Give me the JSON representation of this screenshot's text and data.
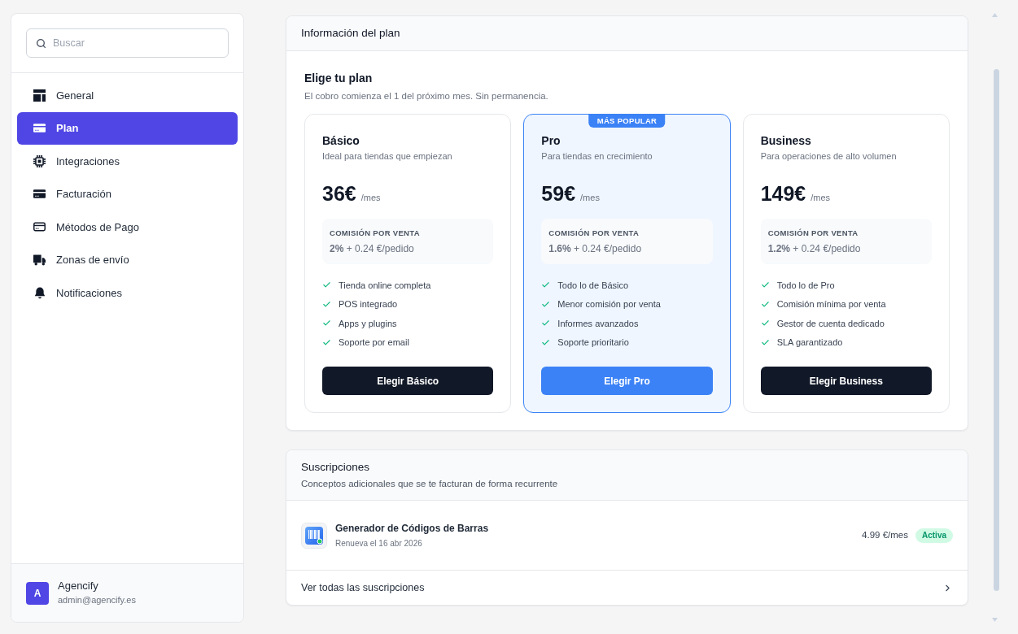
{
  "sidebar": {
    "search": {
      "placeholder": "Buscar"
    },
    "items": [
      {
        "label": "General",
        "selected": false
      },
      {
        "label": "Plan",
        "selected": true
      },
      {
        "label": "Integraciones",
        "selected": false
      },
      {
        "label": "Facturación",
        "selected": false
      },
      {
        "label": "Métodos de Pago",
        "selected": false
      },
      {
        "label": "Zonas de envío",
        "selected": false
      },
      {
        "label": "Notificaciones",
        "selected": false
      }
    ],
    "account": {
      "avatar": "A",
      "name": "Agencify",
      "email": "admin@agencify.es"
    }
  },
  "plan_section": {
    "title": "Información del plan",
    "heading": "Elige tu plan",
    "subtitle": "El cobro comienza el 1 del próximo mes. Sin permanencia.",
    "plans": [
      {
        "name": "Básico",
        "description": "Ideal para tiendas que empiezan",
        "price": "36€",
        "period": "/mes",
        "commission_label": "COMISIÓN POR VENTA",
        "commission": "**2%** + 0.24 €/pedido",
        "features": [
          "Tienda online completa",
          "POS integrado",
          "Apps y plugins",
          "Soporte por email"
        ],
        "button": "Elegir Básico",
        "highlighted": false
      },
      {
        "name": "Pro",
        "badge": "MÁS POPULAR",
        "description": "Para tiendas en crecimiento",
        "price": "59€",
        "period": "/mes",
        "commission_label": "COMISIÓN POR VENTA",
        "commission": "**1.6%** + 0.24 €/pedido",
        "features": [
          "Todo lo de Básico",
          "Menor comisión por venta",
          "Informes avanzados",
          "Soporte prioritario"
        ],
        "button": "Elegir Pro",
        "highlighted": true
      },
      {
        "name": "Business",
        "description": "Para operaciones de alto volumen",
        "price": "149€",
        "period": "/mes",
        "commission_label": "COMISIÓN POR VENTA",
        "commission": "**1.2%** + 0.24 €/pedido",
        "features": [
          "Todo lo de Pro",
          "Comisión mínima por venta",
          "Gestor de cuenta dedicado",
          "SLA garantizado"
        ],
        "button": "Elegir Business",
        "highlighted": false
      }
    ]
  },
  "subscriptions": {
    "title": "Suscripciones",
    "subtitle": "Conceptos adicionales que se te facturan de forma recurrente",
    "items": [
      {
        "name": "Generador de Códigos de Barras",
        "renewal": "Renueva el 16 abr 2026",
        "price": "4.99 €/mes",
        "status": "Activa"
      }
    ],
    "link": "Ver todas las suscripciones"
  }
}
